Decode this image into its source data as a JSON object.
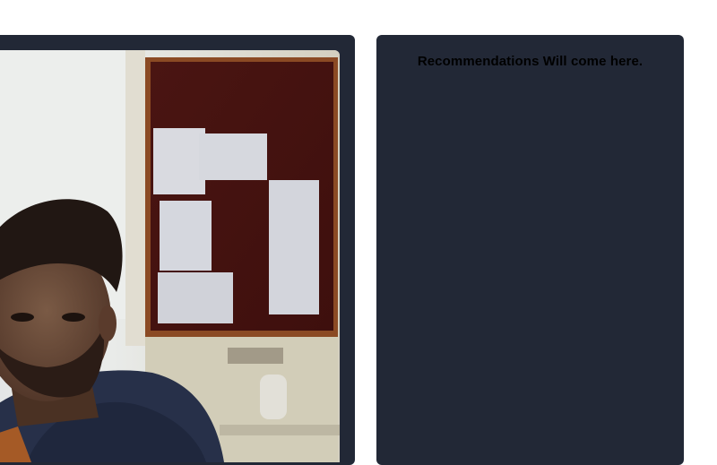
{
  "video": {
    "feed_description_icon": "camera-feed"
  },
  "recommendations": {
    "placeholder": "Recommendations Will come here."
  },
  "colors": {
    "panel_bg": "#222836",
    "page_bg": "#ffffff",
    "text": "#000000"
  }
}
